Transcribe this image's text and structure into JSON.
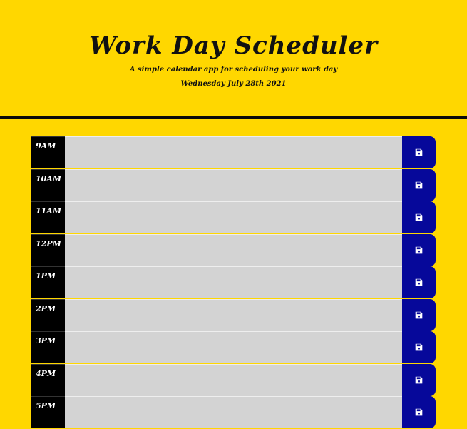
{
  "header": {
    "title": "Work Day Scheduler",
    "subtitle": "A simple calendar app for scheduling your work day",
    "current_day": "Wednesday July 28th 2021"
  },
  "time_blocks": [
    {
      "hour": "9AM",
      "description": ""
    },
    {
      "hour": "10AM",
      "description": ""
    },
    {
      "hour": "11AM",
      "description": ""
    },
    {
      "hour": "12PM",
      "description": ""
    },
    {
      "hour": "1PM",
      "description": ""
    },
    {
      "hour": "2PM",
      "description": ""
    },
    {
      "hour": "3PM",
      "description": ""
    },
    {
      "hour": "4PM",
      "description": ""
    },
    {
      "hour": "5PM",
      "description": ""
    }
  ],
  "save_icon": "floppy-disk-icon",
  "colors": {
    "background": "#ffd700",
    "hour_column": "#000000",
    "textarea": "#d3d3d3",
    "save_button": "#06089a"
  }
}
